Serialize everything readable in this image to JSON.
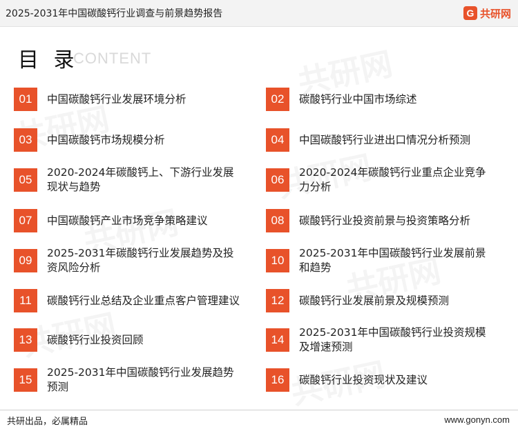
{
  "header": {
    "title": "2025-2031年中国碳酸钙行业调查与前景趋势报告",
    "logo_mark": "G",
    "logo_text": "共研网"
  },
  "toc": {
    "title": "目 录",
    "subtitle": "CONTENT",
    "items": [
      {
        "num": "01",
        "label": "中国碳酸钙行业发展环境分析"
      },
      {
        "num": "02",
        "label": "碳酸钙行业中国市场综述"
      },
      {
        "num": "03",
        "label": "中国碳酸钙市场规模分析"
      },
      {
        "num": "04",
        "label": "中国碳酸钙行业进出口情况分析预测"
      },
      {
        "num": "05",
        "label": "2020-2024年碳酸钙上、下游行业发展现状与趋势"
      },
      {
        "num": "06",
        "label": "2020-2024年碳酸钙行业重点企业竞争力分析"
      },
      {
        "num": "07",
        "label": "中国碳酸钙产业市场竞争策略建议"
      },
      {
        "num": "08",
        "label": "碳酸钙行业投资前景与投资策略分析"
      },
      {
        "num": "09",
        "label": "2025-2031年碳酸钙行业发展趋势及投资风险分析"
      },
      {
        "num": "10",
        "label": "2025-2031年中国碳酸钙行业发展前景和趋势"
      },
      {
        "num": "11",
        "label": "碳酸钙行业总结及企业重点客户管理建议"
      },
      {
        "num": "12",
        "label": "碳酸钙行业发展前景及规模预测"
      },
      {
        "num": "13",
        "label": "碳酸钙行业投资回顾"
      },
      {
        "num": "14",
        "label": "2025-2031年中国碳酸钙行业投资规模及增速预测"
      },
      {
        "num": "15",
        "label": "2025-2031年中国碳酸钙行业发展趋势预测"
      },
      {
        "num": "16",
        "label": "碳酸钙行业投资现状及建议"
      }
    ]
  },
  "footer": {
    "slogan": "共研出品，必属精品",
    "url": "www.gonyn.com"
  },
  "colors": {
    "accent": "#e8522a",
    "header_bg": "#f3f3f3"
  }
}
